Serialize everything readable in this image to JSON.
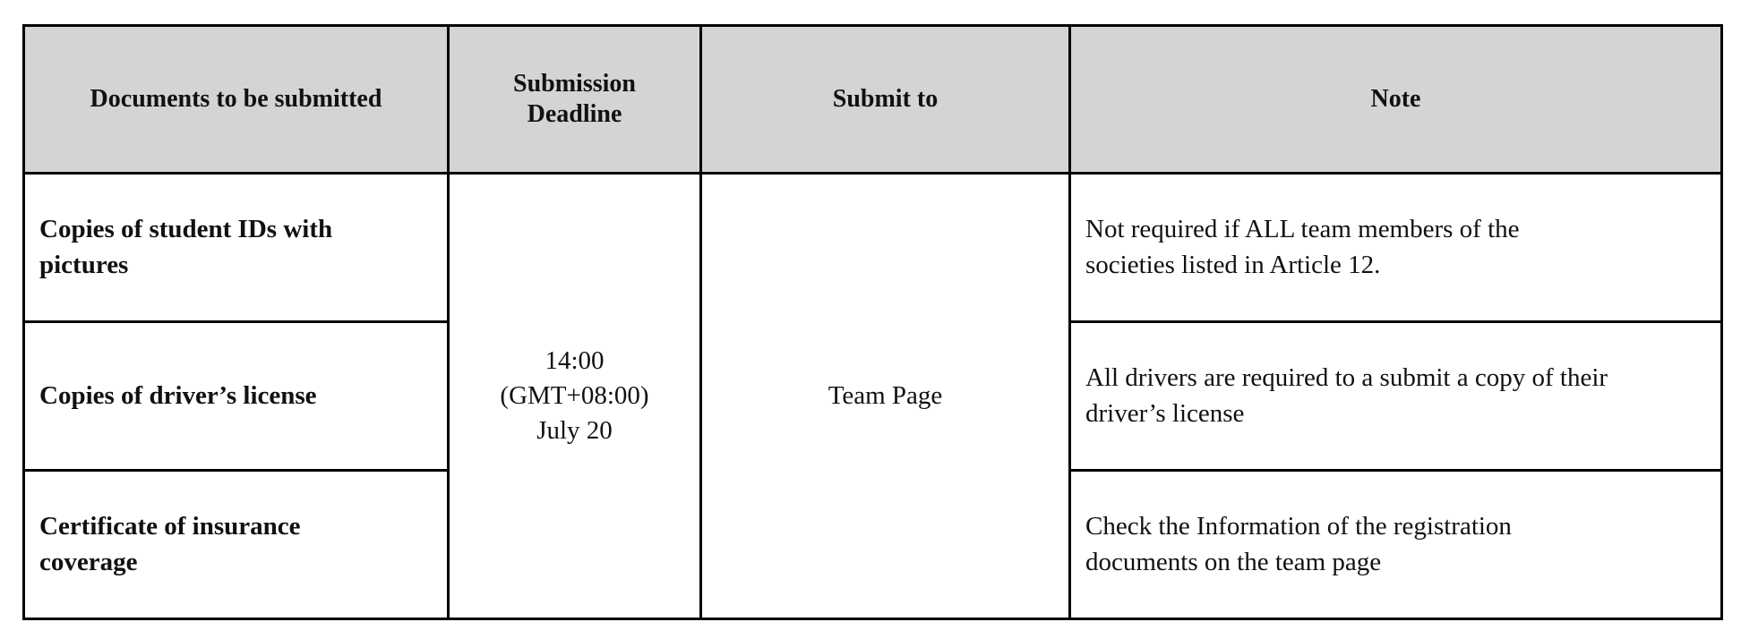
{
  "table": {
    "headers": [
      "Documents to be submitted",
      "Submission Deadline",
      "Submit to",
      "Note"
    ],
    "rows": [
      {
        "document": "Copies of student IDs with pictures",
        "note": "Not required if ALL team members of the societies listed in Article 12."
      },
      {
        "document": "Copies of driver’s license",
        "note": "All drivers are required to a submit a copy of their driver’s license"
      },
      {
        "document": "Certificate of insurance coverage",
        "note": "Check the Information of the registration documents on the team page"
      }
    ],
    "deadline": {
      "time": "14:00",
      "timezone": "(GMT+08:00)",
      "date": "July 20"
    },
    "submit_to": "Team Page"
  }
}
